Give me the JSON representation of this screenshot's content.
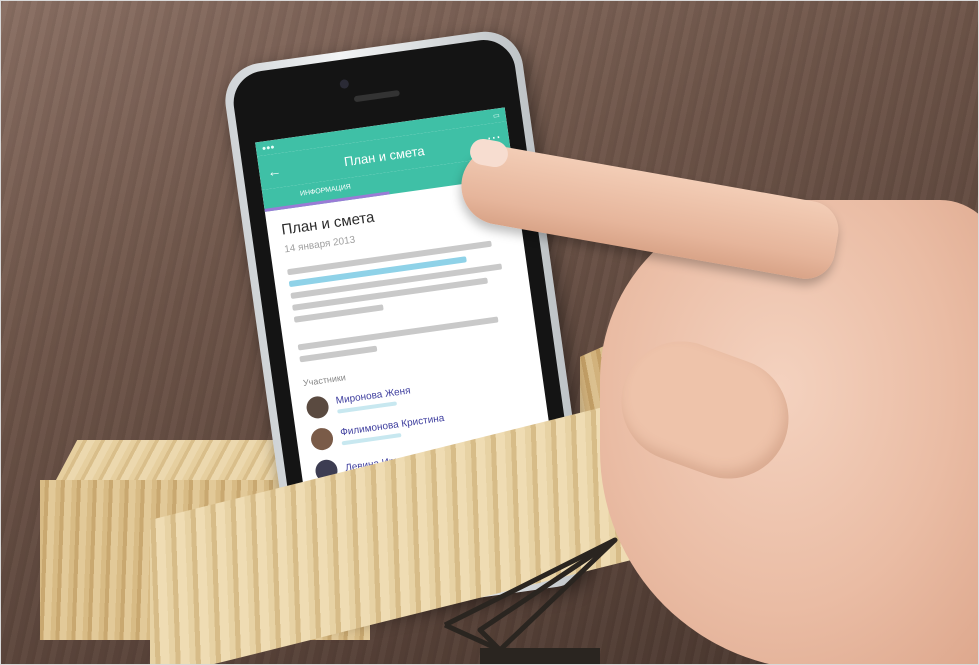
{
  "screen": {
    "title": "План и смета",
    "tab_active": "ИНФОРМАЦИЯ",
    "doc_title": "План и смета",
    "doc_date": "14 января 2013",
    "participants_label": "Участники",
    "participants": [
      {
        "name": "Миронова Женя"
      },
      {
        "name": "Филимонова Кристина"
      },
      {
        "name": "Левина Ирина"
      }
    ]
  },
  "colors": {
    "app_bar": "#3fc0a6",
    "tab_indicator": "#9a7bd6",
    "wood": "#e6cf9f",
    "table": "#6f564a",
    "skin": "#eabca4"
  },
  "icons": {
    "back": "back-arrow-icon",
    "more": "more-icon",
    "menu": "menu-icon",
    "inbox": "inbox-icon",
    "chat": "chat-bubble-icon",
    "add": "plus-icon",
    "logo": "paper-plane-logo-icon"
  }
}
